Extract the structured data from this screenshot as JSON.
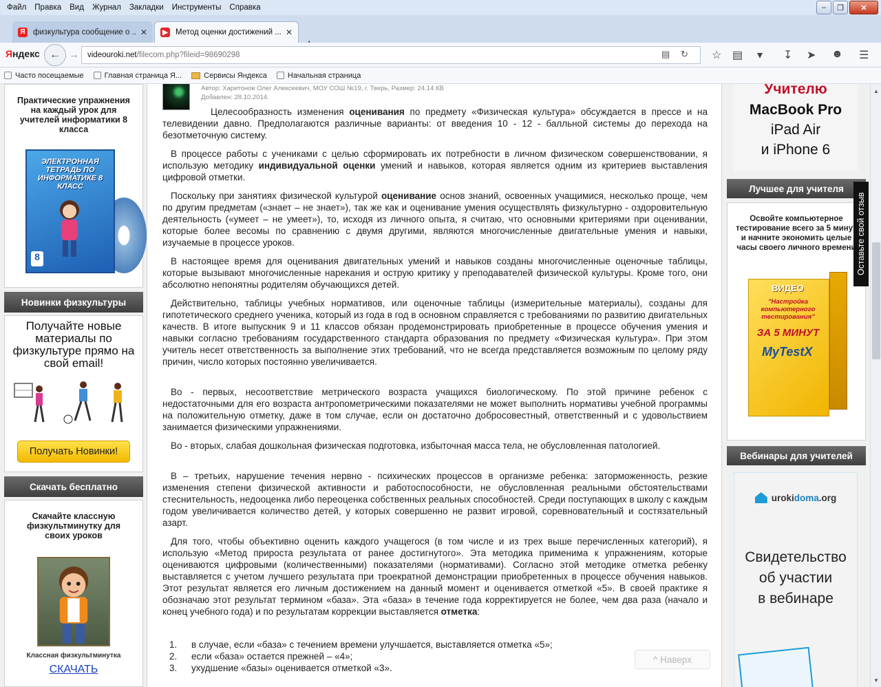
{
  "menu": [
    "Файл",
    "Правка",
    "Вид",
    "Журнал",
    "Закладки",
    "Инструменты",
    "Справка"
  ],
  "tabs": [
    {
      "title": "физкультура сообщение о ...",
      "active": false
    },
    {
      "title": "Метод оценки достижений ...",
      "active": true
    }
  ],
  "nav": {
    "brand_ya": "Я",
    "brand_rest": "ндекс",
    "url_host": "videouroki.net",
    "url_path": "/filecom.php?fileid=98690298"
  },
  "bookmarks": [
    "Часто посещаемые",
    "Главная страница Я...",
    "Сервисы Яндекса",
    "Начальная страница"
  ],
  "left": {
    "promo_title": "Практические упражнения на каждый урок для учителей информатики 8 класса",
    "cd_title": "ЭЛЕКТРОННАЯ ТЕТРАДЬ ПО ИНФОРМАТИКЕ 8 КЛАСС",
    "cd_grade": "8",
    "new_header": "Новинки физкультуры",
    "new_text": "Получайте новые материалы по физкультуре прямо на свой email!",
    "new_button": "Получать Новинки!",
    "download_header": "Скачать бесплатно",
    "download_title": "Скачайте классную физкультминутку для своих уроков",
    "download_caption": "Классная физкультминутка",
    "download_link": "СКАЧАТЬ"
  },
  "article": {
    "meta_author": "Автор: Харитонов Олег Алексеевич, МОУ СОШ №19, г. Тверь,    Размер: 24.14 КВ",
    "meta_date": "Добавлен: 28.10.2014.",
    "p1_a": "Целесообразность изменения ",
    "p1_b": "оценивания",
    "p1_c": " по предмету «Физическая культура» обсуждается в прессе и на телевидении давно. Предполагаются различные варианты: от введения 10 - 12 - балльной системы до перехода на безотметочную систему.",
    "p2_a": "В процессе работы с учениками с целью сформировать их потребности в личном физическом совершенствовании, я использую методику ",
    "p2_b": "индивидуальной оценки",
    "p2_c": " умений и навыков, которая является одним из критериев выставления цифровой отметки.",
    "p3_a": "Поскольку при занятиях физической культурой ",
    "p3_b": "оценивание",
    "p3_c": " основ знаний, освоенных учащимися, несколько проще, чем по другим предметам («знает – не знает»), так же как и оценивание умения осуществлять физкультурно - оздоровительную деятельность («умеет – не умеет»), то, исходя из личного опыта, я считаю, что основными критериями при оценивании, которые более весомы по сравнению с двумя другими, являются многочисленные двигательные умения и навыки, изучаемые в процессе уроков.",
    "p4": "В настоящее время для оценивания двигательных умений и навыков созданы многочисленные оценочные таблицы, которые вызывают многочисленные нарекания и острую критику у преподавателей физической культуры. Кроме того, они абсолютно непонятны родителям обучающихся детей.",
    "p5": "Действительно, таблицы учебных нормативов, или оценочные таблицы (измерительные материалы), созданы для гипотетического среднего ученика, который из года в год в основном справляется с требованиями по развитию двигательных качеств. В итоге выпускник 9 и 11 классов обязан продемонстрировать приобретенные в процессе обучения умения и навыки согласно требованиям государственного стандарта образования по предмету «Физическая культура». При этом учитель несет ответственность за выполнение этих требований, что не всегда представляется возможным по целому ряду причин, число которых постоянно увеличивается.",
    "p6": "Во - первых, несоответствие метрического возраста учащихся биологическому. По этой причине ребенок с недостаточными для его возраста антропометрическими показателями не может выполнить нормативы учебной программы на положительную отметку, даже в том случае, если он достаточно добросовестный, ответственный и с удовольствием занимается физическими упражнениями.",
    "p7": "Во - вторых, слабая дошкольная физическая подготовка, избыточная масса тела, не обусловленная патологией.",
    "p8": "В – третьих, нарушение течения нервно - психических процессов в организме ребенка: заторможенность, резкие изменения степени физической активности и работоспособности, не обусловленная реальными обстоятельствами стеснительность, недооценка либо переоценка собственных реальных способностей. Среди поступающих в школу с каждым годом увеличивается количество детей, у которых совершенно не развит игровой, соревновательный и состязательный азарт.",
    "p9_a": "Для того, чтобы объективно оценить каждого учащегося (в том числе и из трех выше перечисленных категорий), я использую «Метод прироста результата от ранее достигнутого». Эта методика применима к упражнениям, которые оцениваются цифровыми (количественными) показателями (нормативами). Согласно этой методике отметка ребенку выставляется с учетом лучшего результата при троекратной демонстрации приобретенных в процессе обучения навыков. Этот результат является его личным достижением на данный момент и оценивается отметкой «5». В своей практике я обозначаю этот результат термином «база». Эта «база» в течение года корректируется не более, чем два раза (начало и конец учебного года) и по результатам коррекции выставляется ",
    "p9_b": "отметка",
    "p9_c": ":",
    "list": [
      {
        "num": "1.",
        "text": "в случае, если «база» с течением времени улучшается, выставляется отметка «5»;"
      },
      {
        "num": "2.",
        "text": "если «база» остается прежней – «4»;"
      },
      {
        "num": "3.",
        "text": "ухудшение «базы» оценивается отметкой «3»."
      }
    ],
    "to_top": "^ Наверх"
  },
  "right": {
    "mac_teacher": "Учителю",
    "mac_pro": "MacBook Pro",
    "mac_air": "iPad Air",
    "mac_iphone": "и iPhone 6",
    "best_header": "Лучшее для учителя",
    "best_text": "Освойте компьютерное тестирование всего за 5 минут и начните экономить целые часы своего личного времени",
    "box_video": "ВИДЕО",
    "box_title": "\"Настройка компьютерного тестирования\"",
    "box_five": "ЗА 5 МИНУТ",
    "box_brand": "MyTestX",
    "webinar_header": "Вебинары для учителей",
    "uroki_a": "uroki",
    "uroki_b": "doma",
    "uroki_c": ".org",
    "cert_text_1": "Свидетельство",
    "cert_text_2": "об участии",
    "cert_text_3": "в вебинаре"
  },
  "feedback": "Оставьте свой отзыв"
}
